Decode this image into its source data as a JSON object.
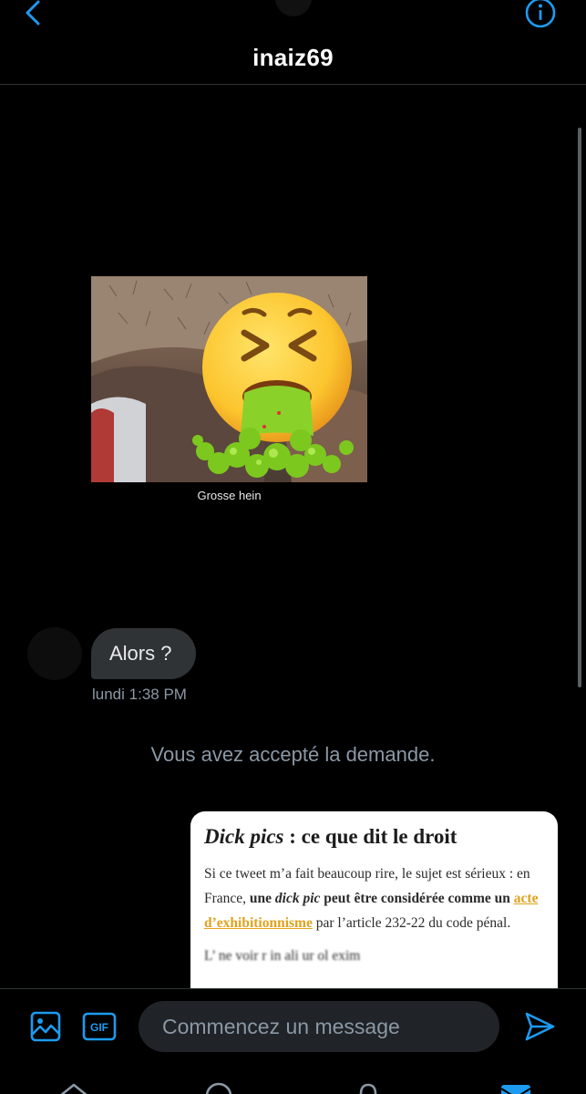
{
  "header": {
    "title": "inaiz69",
    "back_icon": "chevron-left-icon",
    "info_icon": "info-icon"
  },
  "messages": {
    "photo_caption": "Grosse hein",
    "bubble_text": "Alors ?",
    "timestamp": "lundi 1:38 PM",
    "system_note": "Vous avez accepté la demande."
  },
  "article": {
    "heading_italic": "Dick pics",
    "heading_rest": " : ce que dit le droit",
    "p1_a": "Si ce tweet m’a fait beaucoup rire, le sujet est sérieux : en France, ",
    "p1_b": "une ",
    "p1_c": "dick pic",
    "p1_d": " peut être considérée comme un ",
    "p1_link": "acte d’exhibitionnisme",
    "p1_e": " par l’article 232-22 du code pénal.",
    "p2": "L’ ne voir r in ali ur ol exim"
  },
  "composer": {
    "placeholder": "Commencez un message",
    "media_icon": "image-icon",
    "gif_icon": "gif-icon",
    "send_icon": "send-icon"
  },
  "tabs": [
    "home-icon",
    "search-icon",
    "notifications-icon",
    "messages-icon"
  ],
  "colors": {
    "accent": "#1d9bf0",
    "background": "#000000",
    "bubble": "#2f3336",
    "muted_text": "#8b98a5",
    "link": "#e0a21b"
  }
}
